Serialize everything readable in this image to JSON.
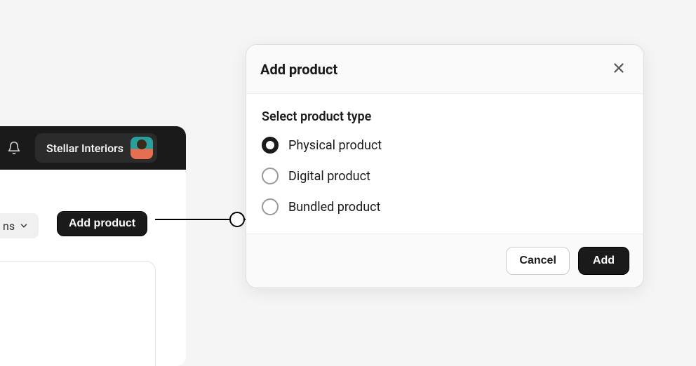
{
  "topbar": {
    "brand_name": "Stellar Interiors"
  },
  "partial_dropdown": {
    "text_fragment": "ns"
  },
  "add_product_button": {
    "label": "Add product"
  },
  "modal": {
    "title": "Add product",
    "section_label": "Select product type",
    "options": [
      {
        "label": "Physical product",
        "selected": true
      },
      {
        "label": "Digital product",
        "selected": false
      },
      {
        "label": "Bundled product",
        "selected": false
      }
    ],
    "cancel_label": "Cancel",
    "add_label": "Add"
  }
}
